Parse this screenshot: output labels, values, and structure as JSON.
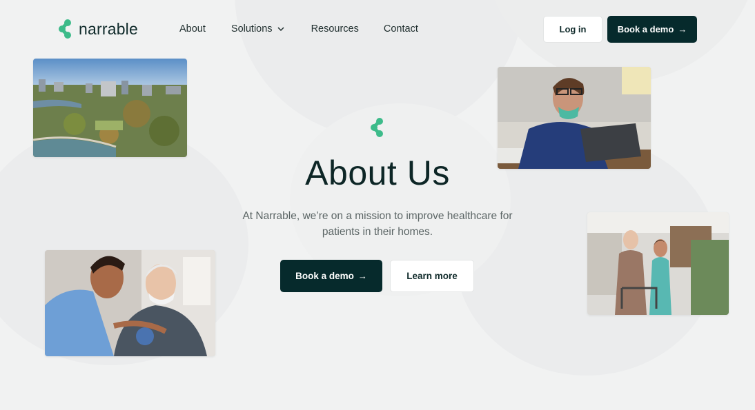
{
  "brand": {
    "name": "narrable",
    "accent": "#3dbb8a",
    "dark": "#062a2c"
  },
  "nav": {
    "about": "About",
    "solutions": "Solutions",
    "resources": "Resources",
    "contact": "Contact"
  },
  "header_actions": {
    "login": "Log in",
    "demo": "Book a demo"
  },
  "hero": {
    "title": "About Us",
    "subtitle": "At Narrable, we’re on a mission to improve healthcare for patients in their homes.",
    "primary_cta": "Book a demo",
    "secondary_cta": "Learn more"
  },
  "icons": {
    "arrow": "→",
    "chevron": "chevron-down-icon",
    "logo": "narrable-logo-icon"
  }
}
